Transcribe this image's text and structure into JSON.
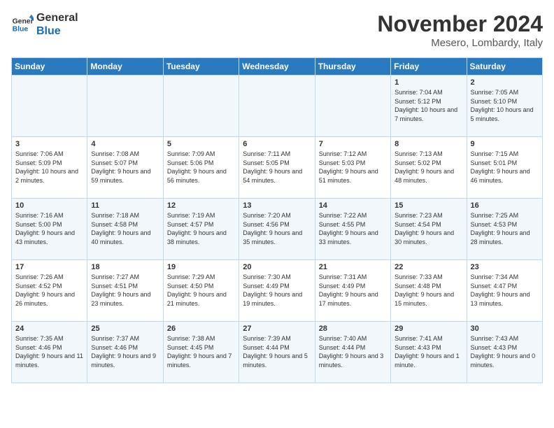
{
  "logo": {
    "line1": "General",
    "line2": "Blue"
  },
  "title": "November 2024",
  "location": "Mesero, Lombardy, Italy",
  "days_of_week": [
    "Sunday",
    "Monday",
    "Tuesday",
    "Wednesday",
    "Thursday",
    "Friday",
    "Saturday"
  ],
  "weeks": [
    [
      {
        "day": "",
        "info": ""
      },
      {
        "day": "",
        "info": ""
      },
      {
        "day": "",
        "info": ""
      },
      {
        "day": "",
        "info": ""
      },
      {
        "day": "",
        "info": ""
      },
      {
        "day": "1",
        "info": "Sunrise: 7:04 AM\nSunset: 5:12 PM\nDaylight: 10 hours and 7 minutes."
      },
      {
        "day": "2",
        "info": "Sunrise: 7:05 AM\nSunset: 5:10 PM\nDaylight: 10 hours and 5 minutes."
      }
    ],
    [
      {
        "day": "3",
        "info": "Sunrise: 7:06 AM\nSunset: 5:09 PM\nDaylight: 10 hours and 2 minutes."
      },
      {
        "day": "4",
        "info": "Sunrise: 7:08 AM\nSunset: 5:07 PM\nDaylight: 9 hours and 59 minutes."
      },
      {
        "day": "5",
        "info": "Sunrise: 7:09 AM\nSunset: 5:06 PM\nDaylight: 9 hours and 56 minutes."
      },
      {
        "day": "6",
        "info": "Sunrise: 7:11 AM\nSunset: 5:05 PM\nDaylight: 9 hours and 54 minutes."
      },
      {
        "day": "7",
        "info": "Sunrise: 7:12 AM\nSunset: 5:03 PM\nDaylight: 9 hours and 51 minutes."
      },
      {
        "day": "8",
        "info": "Sunrise: 7:13 AM\nSunset: 5:02 PM\nDaylight: 9 hours and 48 minutes."
      },
      {
        "day": "9",
        "info": "Sunrise: 7:15 AM\nSunset: 5:01 PM\nDaylight: 9 hours and 46 minutes."
      }
    ],
    [
      {
        "day": "10",
        "info": "Sunrise: 7:16 AM\nSunset: 5:00 PM\nDaylight: 9 hours and 43 minutes."
      },
      {
        "day": "11",
        "info": "Sunrise: 7:18 AM\nSunset: 4:58 PM\nDaylight: 9 hours and 40 minutes."
      },
      {
        "day": "12",
        "info": "Sunrise: 7:19 AM\nSunset: 4:57 PM\nDaylight: 9 hours and 38 minutes."
      },
      {
        "day": "13",
        "info": "Sunrise: 7:20 AM\nSunset: 4:56 PM\nDaylight: 9 hours and 35 minutes."
      },
      {
        "day": "14",
        "info": "Sunrise: 7:22 AM\nSunset: 4:55 PM\nDaylight: 9 hours and 33 minutes."
      },
      {
        "day": "15",
        "info": "Sunrise: 7:23 AM\nSunset: 4:54 PM\nDaylight: 9 hours and 30 minutes."
      },
      {
        "day": "16",
        "info": "Sunrise: 7:25 AM\nSunset: 4:53 PM\nDaylight: 9 hours and 28 minutes."
      }
    ],
    [
      {
        "day": "17",
        "info": "Sunrise: 7:26 AM\nSunset: 4:52 PM\nDaylight: 9 hours and 26 minutes."
      },
      {
        "day": "18",
        "info": "Sunrise: 7:27 AM\nSunset: 4:51 PM\nDaylight: 9 hours and 23 minutes."
      },
      {
        "day": "19",
        "info": "Sunrise: 7:29 AM\nSunset: 4:50 PM\nDaylight: 9 hours and 21 minutes."
      },
      {
        "day": "20",
        "info": "Sunrise: 7:30 AM\nSunset: 4:49 PM\nDaylight: 9 hours and 19 minutes."
      },
      {
        "day": "21",
        "info": "Sunrise: 7:31 AM\nSunset: 4:49 PM\nDaylight: 9 hours and 17 minutes."
      },
      {
        "day": "22",
        "info": "Sunrise: 7:33 AM\nSunset: 4:48 PM\nDaylight: 9 hours and 15 minutes."
      },
      {
        "day": "23",
        "info": "Sunrise: 7:34 AM\nSunset: 4:47 PM\nDaylight: 9 hours and 13 minutes."
      }
    ],
    [
      {
        "day": "24",
        "info": "Sunrise: 7:35 AM\nSunset: 4:46 PM\nDaylight: 9 hours and 11 minutes."
      },
      {
        "day": "25",
        "info": "Sunrise: 7:37 AM\nSunset: 4:46 PM\nDaylight: 9 hours and 9 minutes."
      },
      {
        "day": "26",
        "info": "Sunrise: 7:38 AM\nSunset: 4:45 PM\nDaylight: 9 hours and 7 minutes."
      },
      {
        "day": "27",
        "info": "Sunrise: 7:39 AM\nSunset: 4:44 PM\nDaylight: 9 hours and 5 minutes."
      },
      {
        "day": "28",
        "info": "Sunrise: 7:40 AM\nSunset: 4:44 PM\nDaylight: 9 hours and 3 minutes."
      },
      {
        "day": "29",
        "info": "Sunrise: 7:41 AM\nSunset: 4:43 PM\nDaylight: 9 hours and 1 minute."
      },
      {
        "day": "30",
        "info": "Sunrise: 7:43 AM\nSunset: 4:43 PM\nDaylight: 9 hours and 0 minutes."
      }
    ]
  ]
}
